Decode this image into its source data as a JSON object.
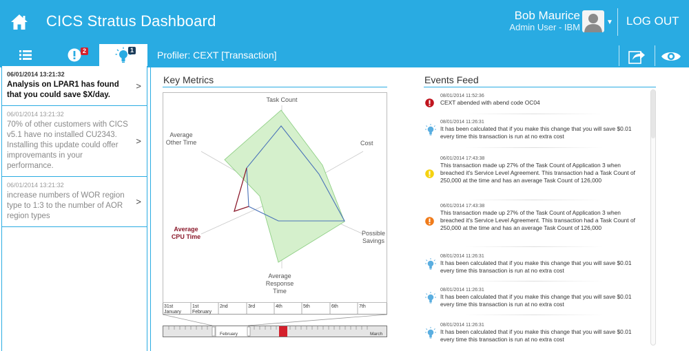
{
  "header": {
    "title": "CICS Stratus Dashboard",
    "user_name": "Bob Maurice",
    "user_role": "Admin User - IBM",
    "logout": "LOG OUT"
  },
  "tabs": {
    "alerts_badge": "2",
    "recommendations_badge": "1"
  },
  "profiler": {
    "title": "Profiler: CEXT [Transaction]"
  },
  "notifications": [
    {
      "timestamp": "06/01/2014  13:21:32",
      "message": "Analysis on LPAR1 has found that you could save $X/day."
    },
    {
      "timestamp": "06/01/2014  13:21:32",
      "message": "70% of other customers with CICS v5.1 have no installed CU2343. Installing this update could offer improvemants in your performance."
    },
    {
      "timestamp": "06/01/2014  13:21:32",
      "message": "increase numbers of WOR region type to 1:3 to the number of AOR region types"
    }
  ],
  "key_metrics": {
    "title": "Key Metrics",
    "labels": {
      "task_count": "Task Count",
      "cost": "Cost",
      "possible_savings_1": "Possible",
      "possible_savings_2": "Savings",
      "avg_response_1": "Average",
      "avg_response_2": "Response",
      "avg_response_3": "Time",
      "avg_cpu_1": "Average",
      "avg_cpu_2": "CPU Time",
      "avg_other_1": "Average",
      "avg_other_2": "Other Time"
    },
    "colors": {
      "fill": "#d5f0cc",
      "baseline": "#8fcf85",
      "current": "#4a72b8",
      "highlight": "#8b1a2c"
    }
  },
  "timeline": {
    "days": [
      {
        "top": "31st",
        "bottom": "January"
      },
      {
        "top": "1st",
        "bottom": "February"
      },
      {
        "top": "2nd",
        "bottom": ""
      },
      {
        "top": "3rd",
        "bottom": ""
      },
      {
        "top": "4th",
        "bottom": ""
      },
      {
        "top": "5th",
        "bottom": ""
      },
      {
        "top": "6th",
        "bottom": ""
      },
      {
        "top": "7th",
        "bottom": ""
      }
    ],
    "scrubber_left_label": "February",
    "scrubber_right_label": "March"
  },
  "events_feed": {
    "title": "Events Feed",
    "items": [
      {
        "type": "error",
        "timestamp": "08/01/2014   11:52:36",
        "message": "CEXT abended with abend code OC04"
      },
      {
        "type": "idea",
        "timestamp": "08/01/2014   11:26:31",
        "message": "It has been calculated that if you make this change that you will save $0.01 every time this transaction is run at no extra cost"
      },
      {
        "type": "warning",
        "timestamp": "06/01/2014   17:43:38",
        "message": "This transaction made up 27% of the Task Count of Application 3 when breached it's Service Level Agreement. This transaction had a Task Count of 250,000 at the time and has an average Task Count of 126,000"
      },
      {
        "type": "alert",
        "timestamp": "06/01/2014   17:43:38",
        "message": "This transaction made up 27% of the Task Count of Application 3 when breached it's Service Level Agreement. This transaction had a Task Count of 250,000 at the time and has an average Task Count of 126,000"
      },
      {
        "type": "idea",
        "timestamp": "08/01/2014   11:26:31",
        "message": "It has been calculated that if you make this change that you will save $0.01 every time this transaction is run at no extra cost"
      },
      {
        "type": "idea",
        "timestamp": "08/01/2014   11:26:31",
        "message": "It has been calculated that if you make this change that you will save $0.01 every time this transaction is run at no extra cost"
      },
      {
        "type": "idea",
        "timestamp": "08/01/2014   11:26:31",
        "message": "It has been calculated that if you make this change that you will save $0.01 every time this transaction is run at no extra cost"
      }
    ]
  }
}
